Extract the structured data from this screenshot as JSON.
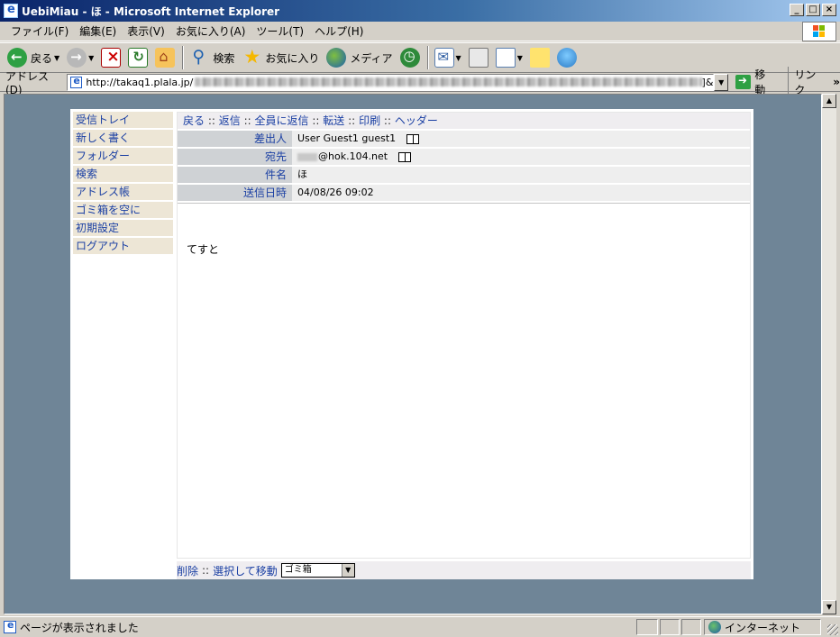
{
  "window": {
    "title": "UebiMiau - ほ - Microsoft Internet Explorer",
    "buttons": {
      "minimize": "_",
      "maximize": "□",
      "close": "×"
    }
  },
  "menu": [
    "ファイル(F)",
    "編集(E)",
    "表示(V)",
    "お気に入り(A)",
    "ツール(T)",
    "ヘルプ(H)"
  ],
  "toolbar": {
    "back": "戻る",
    "search": "検索",
    "favorites": "お気に入り",
    "media": "メディア"
  },
  "address": {
    "label": "アドレス(D)",
    "url_prefix": "http://takaq1.plala.jp/",
    "url_suffix": "]&",
    "go": "移動",
    "links": "リンク",
    "chevron": "»"
  },
  "webmail": {
    "nav": [
      "受信トレイ",
      "新しく書く",
      "フォルダー",
      "検索",
      "アドレス帳",
      "ゴミ箱を空に",
      "初期設定",
      "ログアウト"
    ],
    "actions": [
      "戻る",
      "返信",
      "全員に返信",
      "転送",
      "印刷",
      "ヘッダー"
    ],
    "action_separator": "::",
    "headers": [
      {
        "label": "差出人",
        "value": "User Guest1 guest1",
        "book": true
      },
      {
        "label": "宛先",
        "value": "@hok.104.net",
        "book": true,
        "masked_prefix": true
      },
      {
        "label": "件名",
        "value": "ほ",
        "book": false
      },
      {
        "label": "送信日時",
        "value": "04/08/26 09:02",
        "book": false
      }
    ],
    "body": "てすと",
    "footer": {
      "delete": "削除",
      "move": "選択して移動",
      "separator": "::",
      "folder_selected": "ゴミ箱"
    }
  },
  "status": {
    "text": "ページが表示されました",
    "zone": "インターネット"
  }
}
